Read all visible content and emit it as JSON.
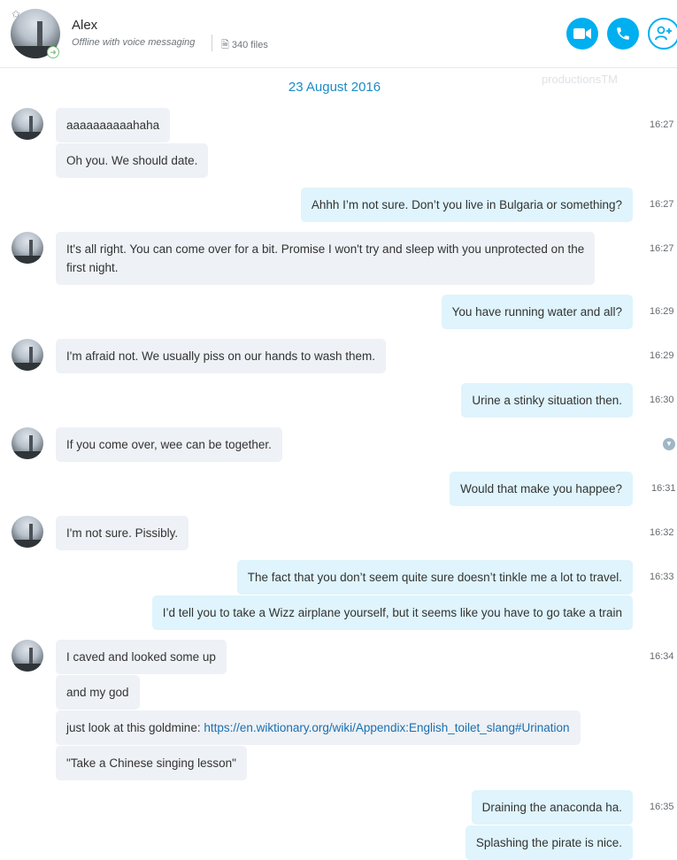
{
  "header": {
    "name": "Alex",
    "status": "Offline with voice messaging",
    "files": "340 files",
    "icons": {
      "favorite": "star-icon",
      "presence": "presence-arrow-icon",
      "files": "file-icon",
      "video": "video-call-icon",
      "call": "phone-call-icon",
      "add": "add-person-icon"
    }
  },
  "watermark": "productionsTM",
  "date": "23 August 2016",
  "messages": [
    {
      "dir": "in",
      "text": "aaaaaaaaaahaha",
      "time": "16:27"
    },
    {
      "dir": "in",
      "text": "Oh you. We should date.",
      "time": ""
    },
    {
      "dir": "out",
      "text": "Ahhh I’m not sure. Don’t you live in Bulgaria or something?",
      "time": "16:27"
    },
    {
      "dir": "in",
      "text": "It's all right. You can come over for a bit. Promise I won't try and sleep with you unprotected on the",
      "text2": "first night.",
      "time": "16:27"
    },
    {
      "dir": "out",
      "text": "You have running water and all?",
      "time": "16:29"
    },
    {
      "dir": "in",
      "text": "I'm afraid not. We usually piss on our hands to wash them.",
      "time": "16:29"
    },
    {
      "dir": "out",
      "text": "Urine a stinky situation then.",
      "time": "16:30"
    },
    {
      "dir": "in",
      "text": "If you come over, wee can be together.",
      "time": ""
    },
    {
      "dir": "out",
      "text": "Would that make you happee?",
      "time": "16:31"
    },
    {
      "dir": "in",
      "text": "I'm not sure. Pissibly.",
      "time": "16:32"
    },
    {
      "dir": "out",
      "text": "The fact that you don’t seem quite sure doesn’t tinkle me a lot to travel.",
      "time": "16:33"
    },
    {
      "dir": "out",
      "text": "I’d tell you to take a Wizz airplane yourself, but it seems like you have to go take a train",
      "time": ""
    },
    {
      "dir": "in",
      "text": "I caved and looked some up",
      "time": "16:34"
    },
    {
      "dir": "in",
      "text": "and my god",
      "time": ""
    },
    {
      "dir": "in",
      "text": "just look at this goldmine: ",
      "link": "https://en.wiktionary.org/wiki/Appendix:English_toilet_slang#Urination",
      "time": ""
    },
    {
      "dir": "in",
      "text": "\"Take a Chinese singing lesson\"",
      "time": ""
    },
    {
      "dir": "out",
      "text": "Draining the anaconda ha.",
      "time": "16:35"
    },
    {
      "dir": "out",
      "text": "Splashing the pirate is nice.",
      "time": ""
    }
  ]
}
